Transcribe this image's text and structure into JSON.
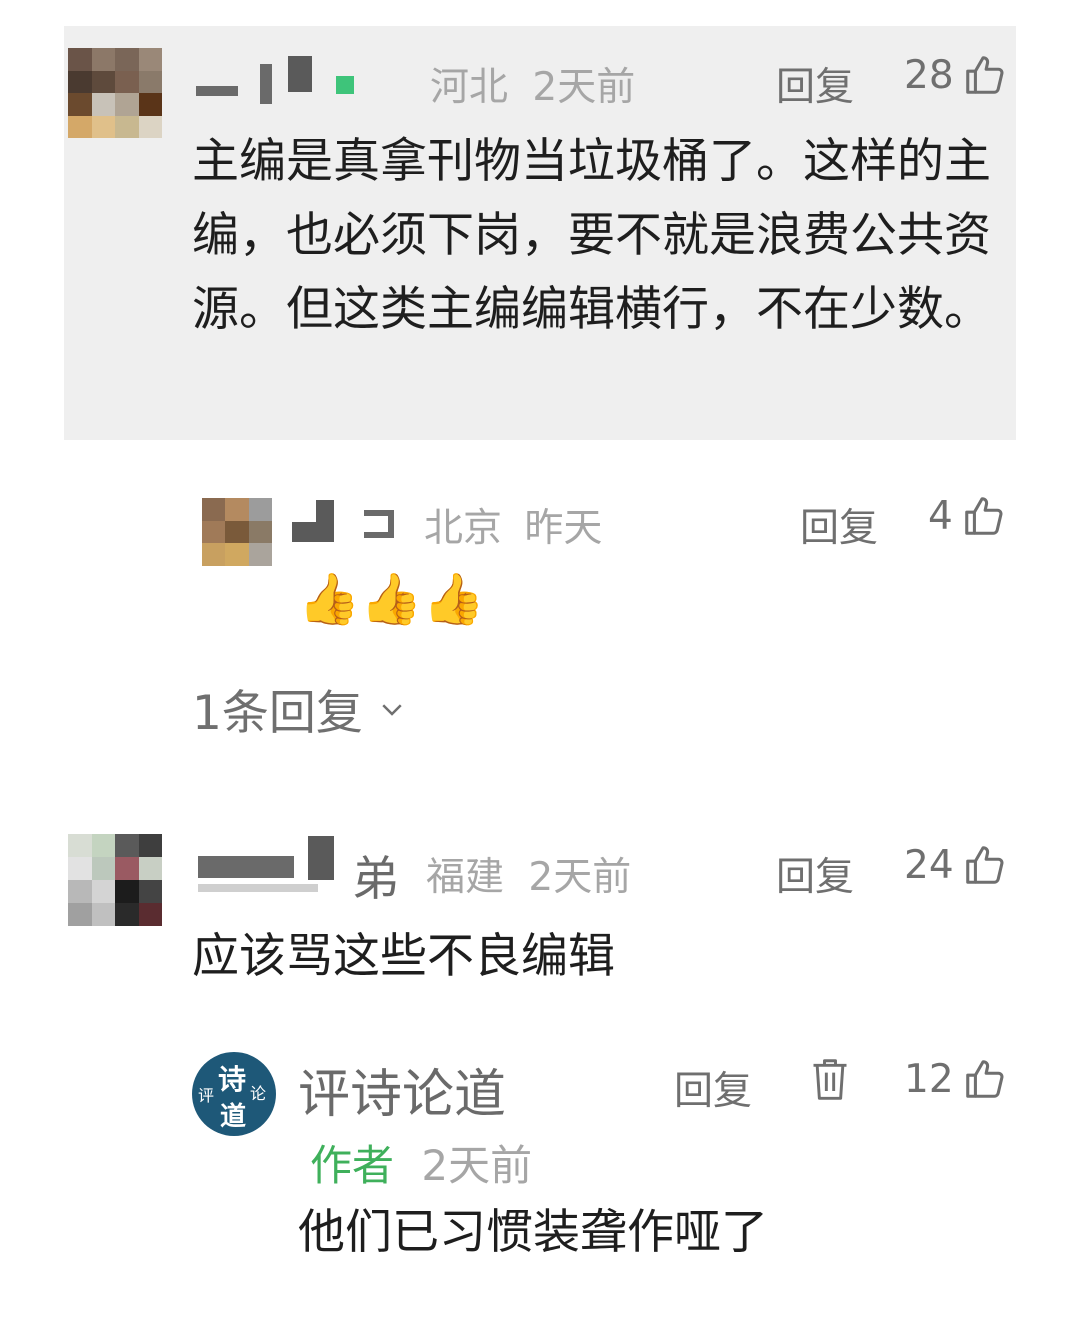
{
  "comments": [
    {
      "author": "",
      "location": "河北",
      "time": "2天前",
      "reply_label": "回复",
      "likes": "28",
      "text": "主编是真拿刊物当垃圾桶了。这样的主编，也必须下岗，要不就是浪费公共资源。但这类主编编辑横行，不在少数。",
      "reply": {
        "author": "",
        "location": "北京",
        "time": "昨天",
        "reply_label": "回复",
        "likes": "4",
        "text_emoji": "👍👍👍"
      },
      "more_replies_label": "1条回复"
    },
    {
      "author_visible_fragment": "弟",
      "location": "福建",
      "time": "2天前",
      "reply_label": "回复",
      "likes": "24",
      "text": "应该骂这些不良编辑",
      "reply": {
        "author": "评诗论道",
        "author_badge": "作者",
        "time": "2天前",
        "reply_label": "回复",
        "likes": "12",
        "text": "他们已习惯装聋作哑了",
        "avatar_text": {
          "main": "诗",
          "left": "评",
          "right": "论",
          "bottom": "道"
        }
      }
    }
  ],
  "colors": {
    "highlight_bg": "#efefef",
    "author_badge": "#3fb05b",
    "meta_gray": "#a6a6a6",
    "action_gray": "#6f6f6f",
    "avatar_blue": "#1e5878"
  },
  "icons": [
    "thumbs-up-icon",
    "delete-icon",
    "chevron-down-icon"
  ]
}
